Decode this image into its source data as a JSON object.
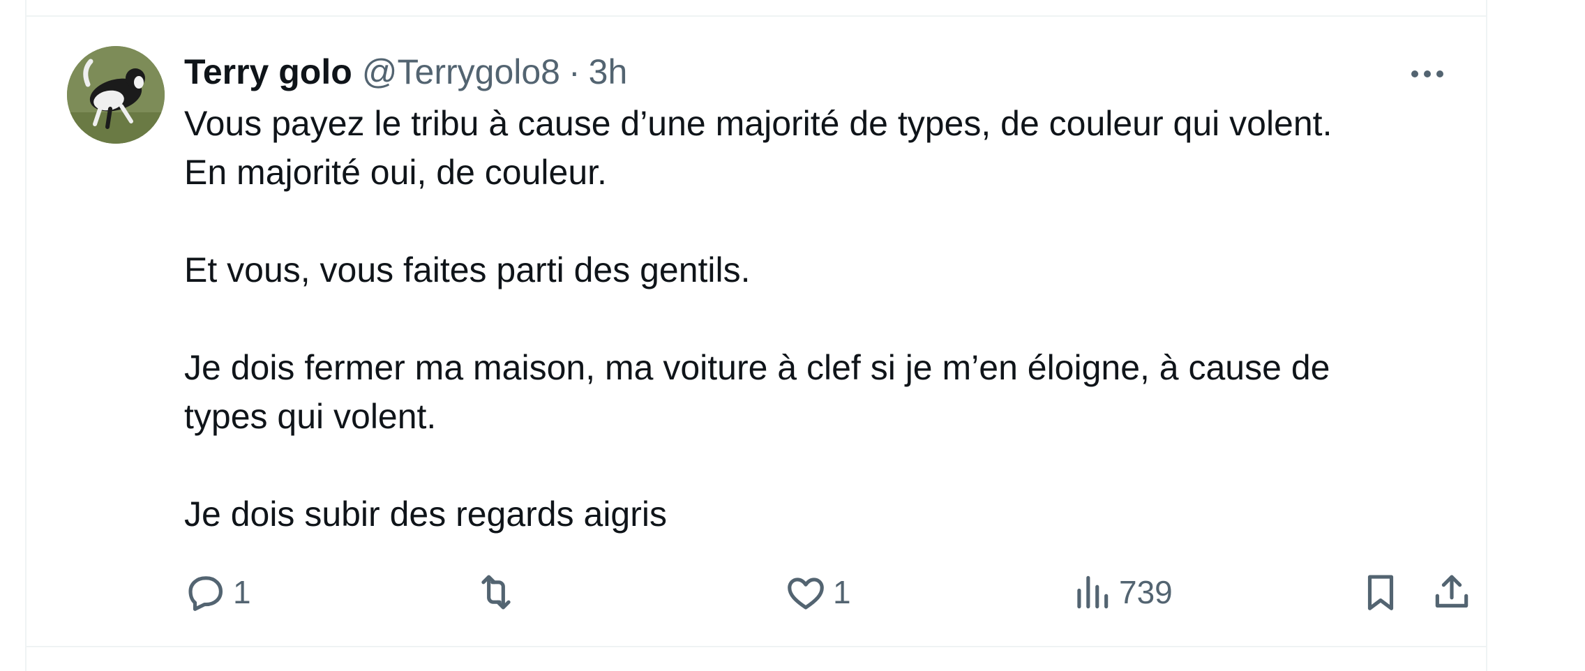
{
  "tweet": {
    "author_name": "Terry golo",
    "author_handle": "@Terrygolo8",
    "separator": "·",
    "timestamp": "3h",
    "body": "Vous payez le tribu à cause d’une majorité de types, de couleur qui volent.\nEn majorité oui, de couleur.\n\nEt vous, vous faites parti des gentils.\n\nJe dois fermer ma maison, ma voiture à clef si je m’en éloigne, à cause de\ntypes qui volent.\n\nJe dois subir des regards aigris",
    "avatar_icon": "dog-avatar"
  },
  "actions": {
    "reply": {
      "icon": "reply-icon",
      "count": "1"
    },
    "repost": {
      "icon": "repost-icon",
      "count": ""
    },
    "like": {
      "icon": "heart-icon",
      "count": "1"
    },
    "views": {
      "icon": "views-icon",
      "count": "739"
    },
    "bookmark": {
      "icon": "bookmark-icon"
    },
    "share": {
      "icon": "share-icon"
    }
  },
  "colors": {
    "text_primary": "#0f1419",
    "text_secondary": "#536471",
    "border": "#eff3f4"
  }
}
